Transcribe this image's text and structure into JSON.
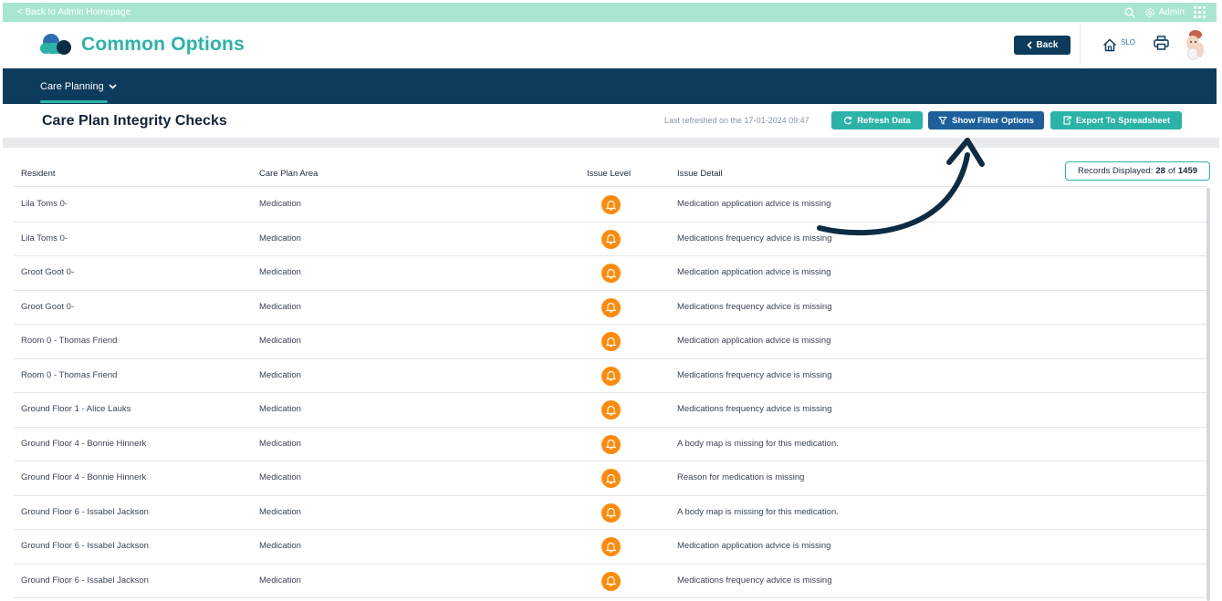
{
  "topbar": {
    "back_label": "< Back to Admin Homepage",
    "admin_label": "Admin"
  },
  "header": {
    "app_title": "Common Options",
    "back_button": "Back",
    "home_badge": "SLO"
  },
  "nav": {
    "items": [
      {
        "label": "Care Planning"
      }
    ]
  },
  "page": {
    "title": "Care Plan Integrity Checks",
    "refreshed": "Last refreshed on the 17-01-2024 09:47",
    "refresh_button": "Refresh Data",
    "filter_button": "Show Filter Options",
    "export_button": "Export To Spreadsheet"
  },
  "table": {
    "columns": [
      "Resident",
      "Care Plan Area",
      "Issue Level",
      "Issue Detail"
    ],
    "records_label": "Records Displayed:",
    "records_shown": "28",
    "records_of": "of",
    "records_total": "1459",
    "rows": [
      {
        "resident": "Lila Toms 0-",
        "area": "Medication",
        "detail": "Medication application advice is missing"
      },
      {
        "resident": "Lila Toms 0-",
        "area": "Medication",
        "detail": "Medications frequency advice is missing"
      },
      {
        "resident": "Groot Goot 0-",
        "area": "Medication",
        "detail": "Medication application advice is missing"
      },
      {
        "resident": "Groot Goot 0-",
        "area": "Medication",
        "detail": "Medications frequency advice is missing"
      },
      {
        "resident": "Room 0 - Thomas Friend",
        "area": "Medication",
        "detail": "Medication application advice is missing"
      },
      {
        "resident": "Room 0 - Thomas Friend",
        "area": "Medication",
        "detail": "Medications frequency advice is missing"
      },
      {
        "resident": "Ground Floor 1 - Alice Lauks",
        "area": "Medication",
        "detail": "Medications frequency advice is missing"
      },
      {
        "resident": "Ground Floor 4 - Bonnie Hinnerk",
        "area": "Medication",
        "detail": "A body map is missing for this medication."
      },
      {
        "resident": "Ground Floor 4 - Bonnie Hinnerk",
        "area": "Medication",
        "detail": "Reason for medication is missing"
      },
      {
        "resident": "Ground Floor 6 - Issabel Jackson",
        "area": "Medication",
        "detail": "A body map is missing for this medication."
      },
      {
        "resident": "Ground Floor 6 - Issabel Jackson",
        "area": "Medication",
        "detail": "Medication application advice is missing"
      },
      {
        "resident": "Ground Floor 6 - Issabel Jackson",
        "area": "Medication",
        "detail": "Medications frequency advice is missing"
      }
    ]
  },
  "colors": {
    "topbar": "#a8e6cf",
    "brand_teal": "#2bb3a8",
    "navy": "#0d3b5c",
    "filter_blue": "#1c5f9b",
    "issue_orange": "#ff8a0a"
  },
  "icons": {
    "issue_level": "bell-icon",
    "topbar": [
      "search-icon",
      "gear-icon",
      "grid-icon"
    ],
    "header": [
      "home-icon",
      "print-icon"
    ]
  }
}
